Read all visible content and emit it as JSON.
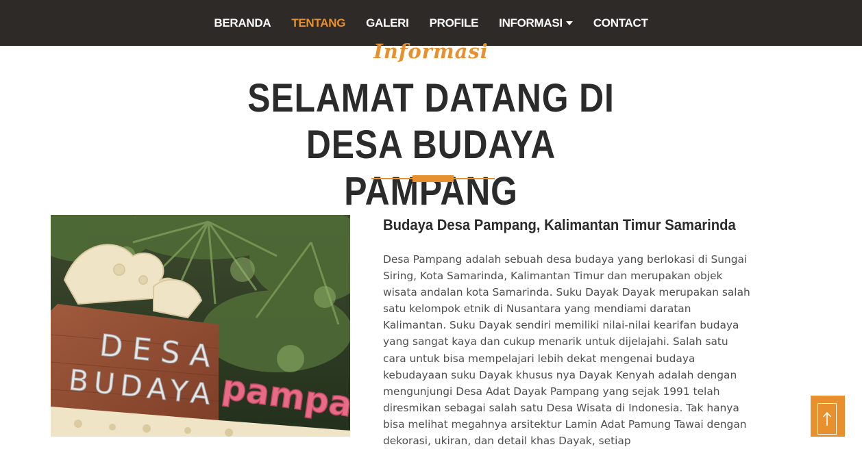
{
  "nav": {
    "items": [
      {
        "label": "BERANDA",
        "active": false,
        "dropdown": false
      },
      {
        "label": "TENTANG",
        "active": true,
        "dropdown": false
      },
      {
        "label": "GALERI",
        "active": false,
        "dropdown": false
      },
      {
        "label": "PROFILE",
        "active": false,
        "dropdown": false
      },
      {
        "label": "INFORMASI",
        "active": false,
        "dropdown": true
      },
      {
        "label": "CONTACT",
        "active": false,
        "dropdown": false
      }
    ]
  },
  "section": {
    "eyebrow": "Informasi",
    "title": "SELAMAT DATANG DI DESA BUDAYA PAMPANG"
  },
  "image": {
    "sign_line1": "DESA",
    "sign_line2": "BUDAYA",
    "sign_pink": "pampan"
  },
  "content": {
    "heading": "Budaya Desa Pampang, Kalimantan Timur Samarinda",
    "body": "Desa Pampang adalah sebuah desa budaya yang berlokasi di Sungai Siring, Kota Samarinda, Kalimantan Timur dan merupakan objek wisata andalan kota Samarinda. Suku Dayak Dayak merupakan salah satu kelompok etnik di Nusantara yang mendiami daratan Kalimantan. Suku Dayak sendiri memiliki nilai-nilai kearifan budaya yang sangat kaya dan cukup menarik untuk dijelajahi. Salah satu cara untuk bisa mempelajari lebih dekat mengenai budaya kebudayaan suku Dayak khusus nya Dayak Kenyah adalah dengan mengunjungi Desa Adat Dayak Pampang yang sejak 1991 telah diresmikan sebagai salah satu Desa Wisata di Indonesia. Tak hanya bisa melihat megahnya arsitektur Lamin Adat Pamung Tawai dengan dekorasi, ukiran, dan detail khas Dayak, setiap"
  },
  "colors": {
    "accent": "#e8902d",
    "navbar": "#2e2a27",
    "heading": "#2b2b2b",
    "body_text": "#4e4e4e"
  },
  "icons": {
    "back_to_top": "arrow-up-icon",
    "dropdown": "caret-down-icon"
  }
}
